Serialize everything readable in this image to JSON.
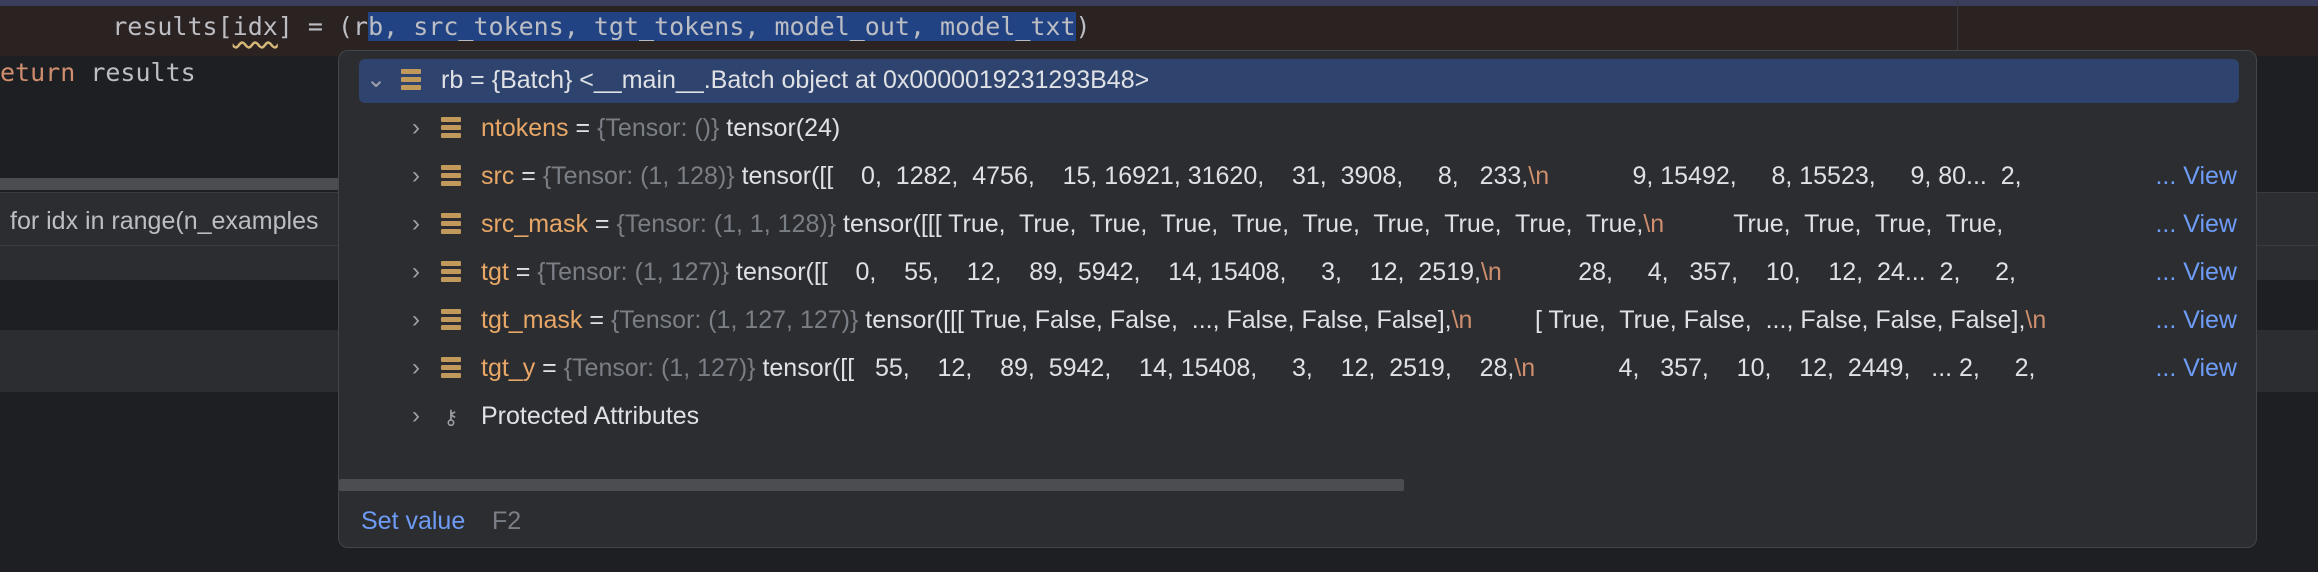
{
  "editor": {
    "line1_indent": "    ",
    "line1_a": "results[",
    "line1_idx": "idx",
    "line1_b": "] = (r",
    "line1_sel": "b, src_tokens, tgt_tokens, model_out, model_txt",
    "line1_c": ")",
    "line2_kw": "eturn",
    "line2_rest": " results",
    "folded_line": "for idx in range(n_examples"
  },
  "popup": {
    "rows": [
      {
        "name": "rb",
        "type": "",
        "value": "{Batch} <__main__.Batch object at 0x0000019231293B48>",
        "expanded": true
      },
      {
        "name": "ntokens",
        "type": "{Tensor: ()}",
        "value": "tensor(24)"
      },
      {
        "name": "src",
        "type": "{Tensor: (1, 128)}",
        "value": "tensor([[    0,  1282,  4756,    15, 16921, 31620,    31,  3908,     8,   233,",
        "nl": "\\n",
        "value2": "            9, 15492,     8, 15523,     9, 80...  2,"
      },
      {
        "name": "src_mask",
        "type": "{Tensor: (1, 1, 128)}",
        "value": "tensor([[[ True,  True,  True,  True,  True,  True,  True,  True,  True,  True,",
        "nl": "\\n",
        "value2": "          True,  True,  True,  True,"
      },
      {
        "name": "tgt",
        "type": "{Tensor: (1, 127)}",
        "value": "tensor([[    0,    55,    12,    89,  5942,    14, 15408,     3,    12,  2519,",
        "nl": "\\n",
        "value2": "           28,     4,   357,    10,    12,  24...  2,     2,"
      },
      {
        "name": "tgt_mask",
        "type": "{Tensor: (1, 127, 127)}",
        "value": "tensor([[[ True, False, False,  ..., False, False, False],",
        "nl": "\\n",
        "value2": "         [ True,  True, False,  ..., False, False, False],",
        "nl2": "\\n"
      },
      {
        "name": "tgt_y",
        "type": "{Tensor: (1, 127)}",
        "value": "tensor([[   55,    12,    89,  5942,    14, 15408,     3,    12,  2519,    28,",
        "nl": "\\n",
        "value2": "            4,   357,    10,    12,  2449,   ... 2,     2,"
      },
      {
        "name": "Protected Attributes",
        "type": "",
        "value": ""
      }
    ],
    "view_label": "... View",
    "set_value_label": "Set value",
    "set_value_shortcut": "F2"
  },
  "colors": {
    "field_name": "#e8a767",
    "type_hint": "#7a7e85",
    "link": "#6e9bf5",
    "selection": "#2e436e",
    "escape": "#cf8e6d"
  },
  "icons": {
    "expand": "chevron-right-icon",
    "collapse": "chevron-down-icon",
    "field": "field-icon",
    "protected": "key-icon"
  }
}
